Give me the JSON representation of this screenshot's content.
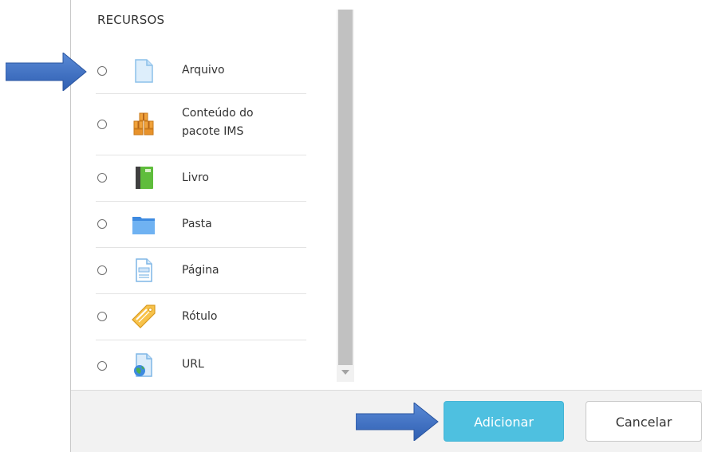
{
  "resources": {
    "title": "RECURSOS",
    "items": [
      {
        "label": "Arquivo",
        "icon": "file-icon"
      },
      {
        "label": "Conteúdo do pacote IMS",
        "label_line1": "Conteúdo do",
        "label_line2": "pacote IMS",
        "icon": "ims-package-icon"
      },
      {
        "label": "Livro",
        "icon": "book-icon"
      },
      {
        "label": "Pasta",
        "icon": "folder-icon"
      },
      {
        "label": "Página",
        "icon": "page-icon"
      },
      {
        "label": "Rótulo",
        "icon": "label-tag-icon"
      },
      {
        "label": "URL",
        "icon": "url-globe-icon"
      }
    ]
  },
  "footer": {
    "add_label": "Adicionar",
    "cancel_label": "Cancelar"
  },
  "colors": {
    "primary_button": "#4ec0e0",
    "annotation_arrow": "#3f6fc2"
  }
}
